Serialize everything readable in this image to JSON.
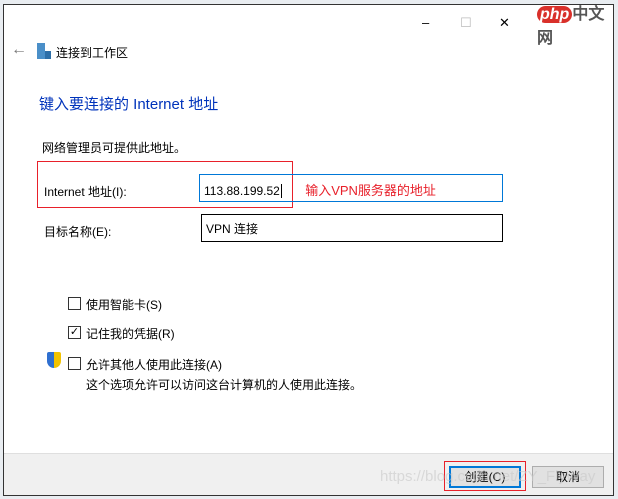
{
  "window": {
    "title": "连接到工作区",
    "minimize": "–",
    "maximize": "☐",
    "close": "✕",
    "back": "←"
  },
  "heading": "键入要连接的 Internet 地址",
  "description": "网络管理员可提供此地址。",
  "fields": {
    "address_label": "Internet 地址(I):",
    "address_value": "113.88.199.52",
    "address_annotation": "输入VPN服务器的地址",
    "name_label": "目标名称(E):",
    "name_value": "VPN 连接"
  },
  "options": [
    {
      "label": "使用智能卡(S)",
      "checked": false
    },
    {
      "label": "记住我的凭据(R)",
      "checked": true
    },
    {
      "label": "允许其他人使用此连接(A)",
      "checked": false
    }
  ],
  "allow_note": "这个选项允许可以访问这台计算机的人使用此连接。",
  "buttons": {
    "create": "创建(C)",
    "cancel": "取消"
  },
  "watermark": "https://blog.csdn.net/ZY_FlyWay",
  "logo": "php中文网",
  "colors": {
    "heading": "#0033bb",
    "annotation": "#e8202a",
    "accent": "#0078d7"
  }
}
